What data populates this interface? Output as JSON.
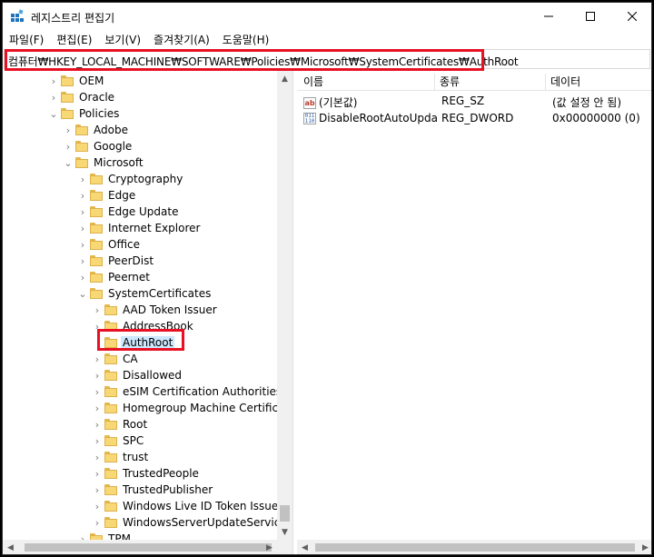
{
  "window": {
    "title": "레지스트리 편집기",
    "icons": {
      "app": "registry-editor-icon",
      "minimize": "minimize-icon",
      "maximize": "maximize-icon",
      "close": "close-icon"
    }
  },
  "menu": [
    "파일(F)",
    "편집(E)",
    "보기(V)",
    "즐겨찾기(A)",
    "도움말(H)"
  ],
  "address": {
    "path": "컴퓨터₩HKEY_LOCAL_MACHINE₩SOFTWARE₩Policies₩Microsoft₩SystemCertificates₩AuthRoot"
  },
  "tree": {
    "items": [
      {
        "label": "OEM",
        "expander": "collapsed"
      },
      {
        "label": "Oracle",
        "expander": "collapsed"
      },
      {
        "label": "Policies",
        "expander": "expanded"
      },
      {
        "label": "Adobe",
        "expander": "collapsed"
      },
      {
        "label": "Google",
        "expander": "collapsed"
      },
      {
        "label": "Microsoft",
        "expander": "expanded"
      },
      {
        "label": "Cryptography",
        "expander": "collapsed"
      },
      {
        "label": "Edge",
        "expander": "collapsed"
      },
      {
        "label": "Edge Update",
        "expander": "collapsed"
      },
      {
        "label": "Internet Explorer",
        "expander": "collapsed"
      },
      {
        "label": "Office",
        "expander": "collapsed"
      },
      {
        "label": "PeerDist",
        "expander": "collapsed"
      },
      {
        "label": "Peernet",
        "expander": "collapsed"
      },
      {
        "label": "SystemCertificates",
        "expander": "expanded"
      },
      {
        "label": "AAD Token Issuer",
        "expander": "collapsed"
      },
      {
        "label": "AddressBook",
        "expander": "collapsed"
      },
      {
        "label": "AuthRoot",
        "expander": "none",
        "selected": true
      },
      {
        "label": "CA",
        "expander": "collapsed"
      },
      {
        "label": "Disallowed",
        "expander": "collapsed"
      },
      {
        "label": "eSIM Certification Authorities",
        "expander": "collapsed"
      },
      {
        "label": "Homegroup Machine Certificates",
        "expander": "collapsed"
      },
      {
        "label": "Root",
        "expander": "collapsed"
      },
      {
        "label": "SPC",
        "expander": "collapsed"
      },
      {
        "label": "trust",
        "expander": "collapsed"
      },
      {
        "label": "TrustedPeople",
        "expander": "collapsed"
      },
      {
        "label": "TrustedPublisher",
        "expander": "collapsed"
      },
      {
        "label": "Windows Live ID Token Issuer",
        "expander": "collapsed"
      },
      {
        "label": "WindowsServerUpdateServices",
        "expander": "collapsed"
      },
      {
        "label": "TPM",
        "expander": "collapsed"
      }
    ]
  },
  "values": {
    "headers": {
      "name": "이름",
      "type": "종류",
      "data": "데이터"
    },
    "rows": [
      {
        "icon": "string-value-icon",
        "name": "(기본값)",
        "type": "REG_SZ",
        "data": "(값 설정 안 됨)"
      },
      {
        "icon": "binary-value-icon",
        "name": "DisableRootAutoUpdate",
        "type": "REG_DWORD",
        "data": "0x00000000 (0)"
      }
    ]
  },
  "colors": {
    "highlight": "#e81123",
    "selection": "#cce8ff",
    "folder": "#f8d775"
  }
}
